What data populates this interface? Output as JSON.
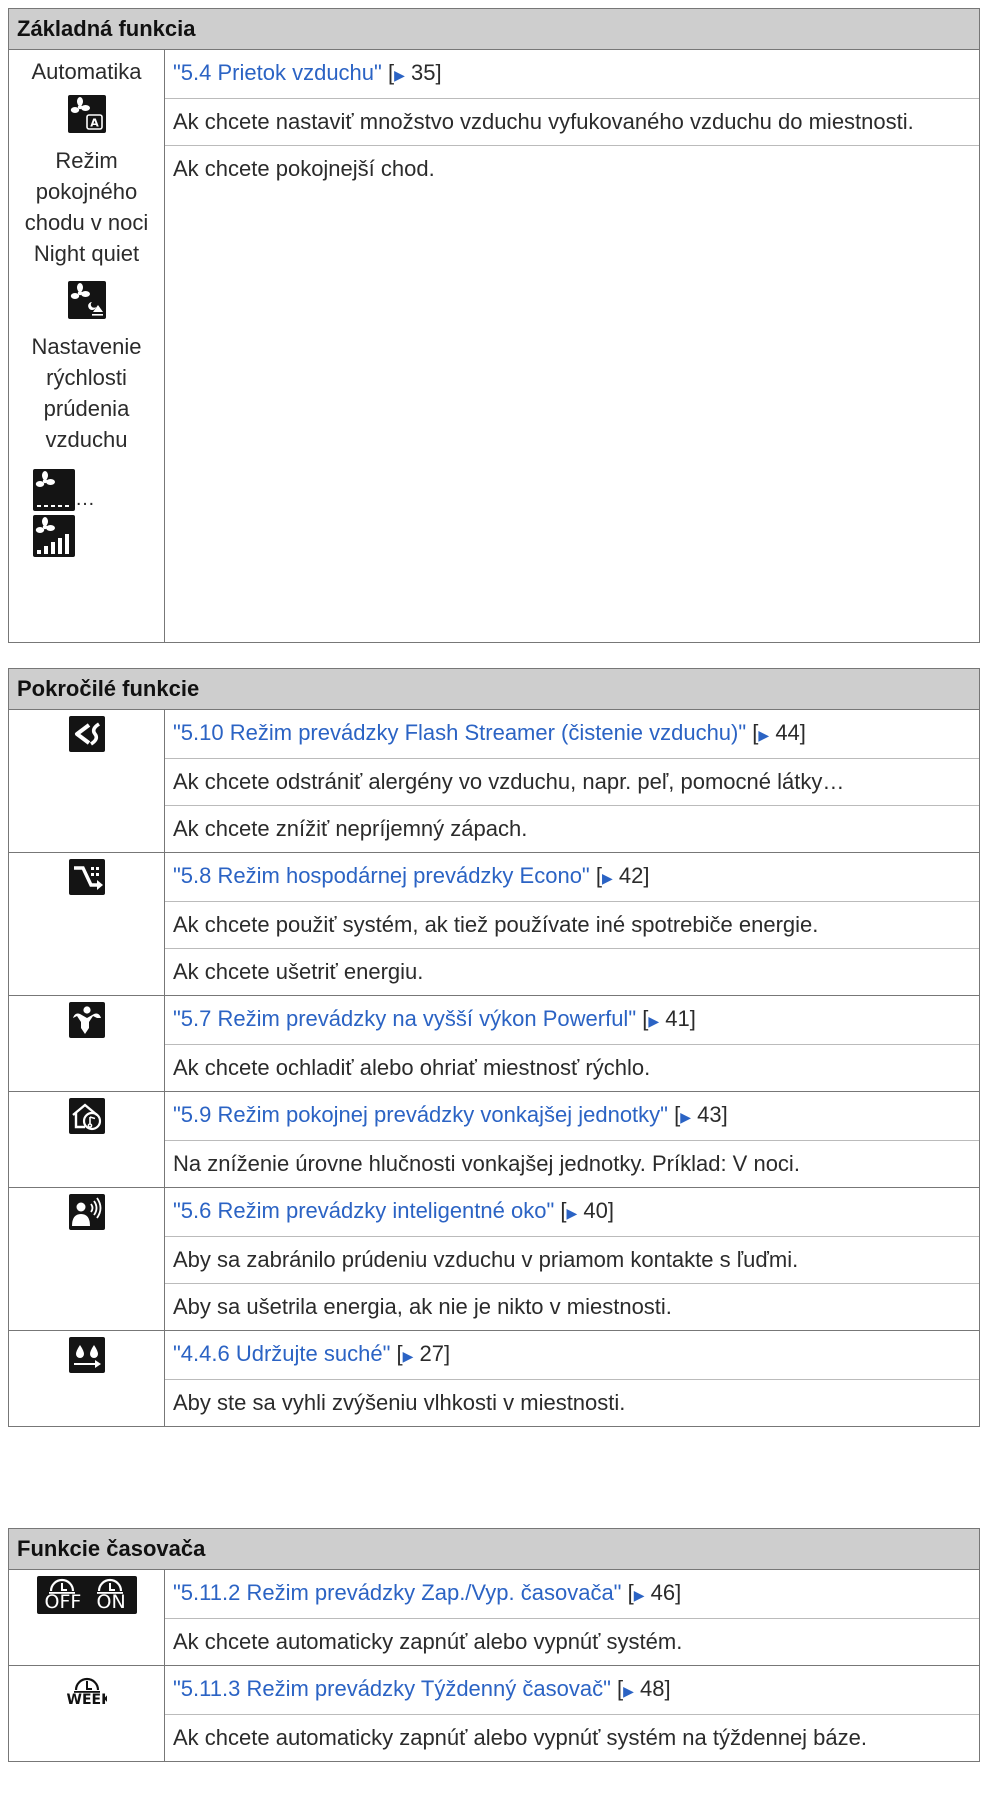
{
  "basic": {
    "header": "Základná funkcia",
    "labels": {
      "auto": "Automatika",
      "night_quiet": "Režim pokojného chodu v noci Night quiet",
      "speed": "Nastavenie rýchlosti prúdenia vzduchu",
      "ellipsis": "…"
    },
    "link_title": "\"5.4 Prietok vzduchu\"",
    "link_page": "35",
    "lines": [
      "Ak chcete nastaviť množstvo vzduchu vyfukovaného vzduchu do miestnosti.",
      "Ak chcete pokojnejší chod."
    ]
  },
  "advanced": {
    "header": "Pokročilé funkcie",
    "rows": [
      {
        "icon": "flash-streamer-icon",
        "title": "\"5.10 Režim prevádzky Flash Streamer (čistenie vzduchu)\"",
        "page": "44",
        "lines": [
          "Ak chcete odstrániť alergény vo vzduchu, napr. peľ, pomocné látky…",
          "Ak chcete znížiť nepríjemný zápach."
        ]
      },
      {
        "icon": "econo-icon",
        "title": "\"5.8 Režim hospodárnej prevádzky Econo\"",
        "page": "42",
        "lines": [
          "Ak chcete použiť systém, ak tiež používate iné spotrebiče energie.",
          "Ak chcete ušetriť energiu."
        ]
      },
      {
        "icon": "powerful-icon",
        "title": "\"5.7 Režim prevádzky na vyšší výkon Powerful\"",
        "page": "41",
        "lines": [
          "Ak chcete ochladiť alebo ohriať miestnosť rýchlo."
        ]
      },
      {
        "icon": "outdoor-quiet-icon",
        "title": "\"5.9 Režim pokojnej prevádzky vonkajšej jednotky\"",
        "page": "43",
        "lines": [
          "Na zníženie úrovne hlučnosti vonkajšej jednotky. Príklad: V noci."
        ]
      },
      {
        "icon": "intelligent-eye-icon",
        "title": "\"5.6 Režim prevádzky inteligentné oko\"",
        "page": "40",
        "lines": [
          "Aby sa zabránilo prúdeniu vzduchu v priamom kontakte s ľuďmi.",
          "Aby sa ušetrila energia, ak nie je nikto v miestnosti."
        ]
      },
      {
        "icon": "keep-dry-icon",
        "title": "\"4.4.6 Udržujte suché\"",
        "page": "27",
        "lines": [
          "Aby ste sa vyhli zvýšeniu vlhkosti v miestnosti."
        ]
      }
    ]
  },
  "timer": {
    "header": "Funkcie časovača",
    "icon_text": {
      "off": "OFF",
      "on": "ON",
      "week": "WEEK"
    },
    "rows": [
      {
        "icon": "on-off-timer-icon",
        "title": "\"5.11.2 Režim prevádzky Zap./Vyp. časovača\"",
        "page": "46",
        "lines": [
          "Ak chcete automaticky zapnúť alebo vypnúť systém."
        ]
      },
      {
        "icon": "week-timer-icon",
        "title": "\"5.11.3 Režim prevádzky Týždenný časovač\"",
        "page": "48",
        "lines": [
          "Ak chcete automaticky zapnúť alebo vypnúť systém na týždennej báze."
        ]
      }
    ]
  }
}
